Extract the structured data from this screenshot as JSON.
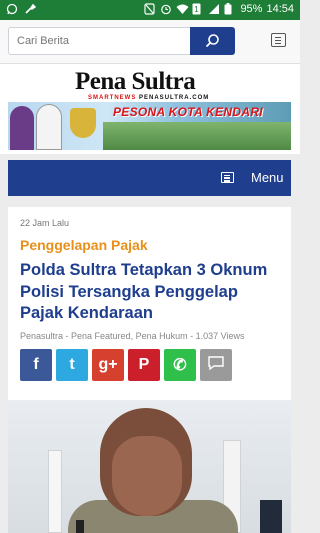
{
  "status_bar": {
    "battery": "95%",
    "time": "14:54",
    "left_icons": [
      "whatsapp-icon",
      "tools-icon"
    ],
    "right_icons": [
      "mute-icon",
      "alarm-icon",
      "wifi-icon",
      "sim-icon",
      "signal-icon",
      "battery-icon"
    ]
  },
  "header": {
    "search_placeholder": "Cari Berita",
    "search_icon": "search-icon",
    "menu_icon": "hamburger-icon"
  },
  "brand": {
    "logo_title": "Pena Sultra",
    "logo_subtitle_red": "SMARTNEWS",
    "logo_subtitle_rest": "PENASULTRA.COM",
    "banner_text": "PESONA KOTA KENDARI"
  },
  "menu": {
    "label": "Menu"
  },
  "article": {
    "date": "22 Jam Lalu",
    "category": "Penggelapan Pajak",
    "title": "Polda Sultra Tetapkan 3 Oknum Polisi Tersangka Penggelap Pajak Kendaraan",
    "meta": "Penasultra - Pena Featured, Pena Hukum - 1.037 Views",
    "share_buttons": [
      {
        "name": "facebook",
        "glyph": "f",
        "color": "#3b5998"
      },
      {
        "name": "twitter",
        "glyph": "t",
        "color": "#2da8e0"
      },
      {
        "name": "google-plus",
        "glyph": "g+",
        "color": "#d6412f"
      },
      {
        "name": "pinterest",
        "glyph": "P",
        "color": "#cb1f2b"
      },
      {
        "name": "whatsapp",
        "glyph": "✆",
        "color": "#2ec04a"
      },
      {
        "name": "comment",
        "glyph": "",
        "color": "#9a9a9a"
      }
    ]
  }
}
